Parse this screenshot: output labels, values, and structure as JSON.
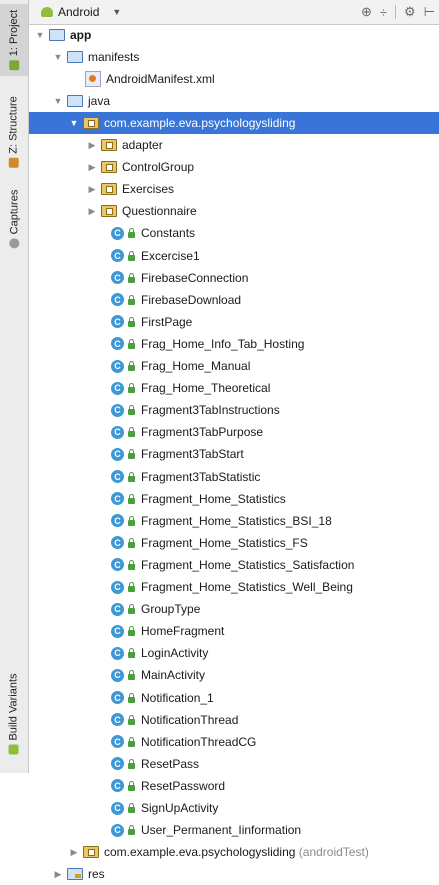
{
  "sidebar": {
    "project_tab": "1: Project",
    "structure_tab": "Z: Structure",
    "captures_tab": "Captures",
    "build_variants_tab": "Build Variants"
  },
  "toolbar": {
    "view_selector": "Android",
    "icons": [
      "settings-sync-icon",
      "collapse-icon",
      "gear-icon",
      "pin-icon"
    ]
  },
  "tree": {
    "app": "app",
    "manifests": "manifests",
    "manifest_file": "AndroidManifest.xml",
    "java": "java",
    "main_package": "com.example.eva.psychologysliding",
    "subpackages": [
      "adapter",
      "ControlGroup",
      "Exercises",
      "Questionnaire"
    ],
    "classes": [
      "Constants",
      "Excercise1",
      "FirebaseConnection",
      "FirebaseDownload",
      "FirstPage",
      "Frag_Home_Info_Tab_Hosting",
      "Frag_Home_Manual",
      "Frag_Home_Theoretical",
      "Fragment3TabInstructions",
      "Fragment3TabPurpose",
      "Fragment3TabStart",
      "Fragment3TabStatistic",
      "Fragment_Home_Statistics",
      "Fragment_Home_Statistics_BSI_18",
      "Fragment_Home_Statistics_FS",
      "Fragment_Home_Statistics_Satisfaction",
      "Fragment_Home_Statistics_Well_Being",
      "GroupType",
      "HomeFragment",
      "LoginActivity",
      "MainActivity",
      "Notification_1",
      "NotificationThread",
      "NotificationThreadCG",
      "ResetPass",
      "ResetPassword",
      "SignUpActivity",
      "User_Permanent_Iinformation"
    ],
    "test_package": "com.example.eva.psychologysliding",
    "test_package_suffix": "(androidTest)",
    "res": "res"
  }
}
